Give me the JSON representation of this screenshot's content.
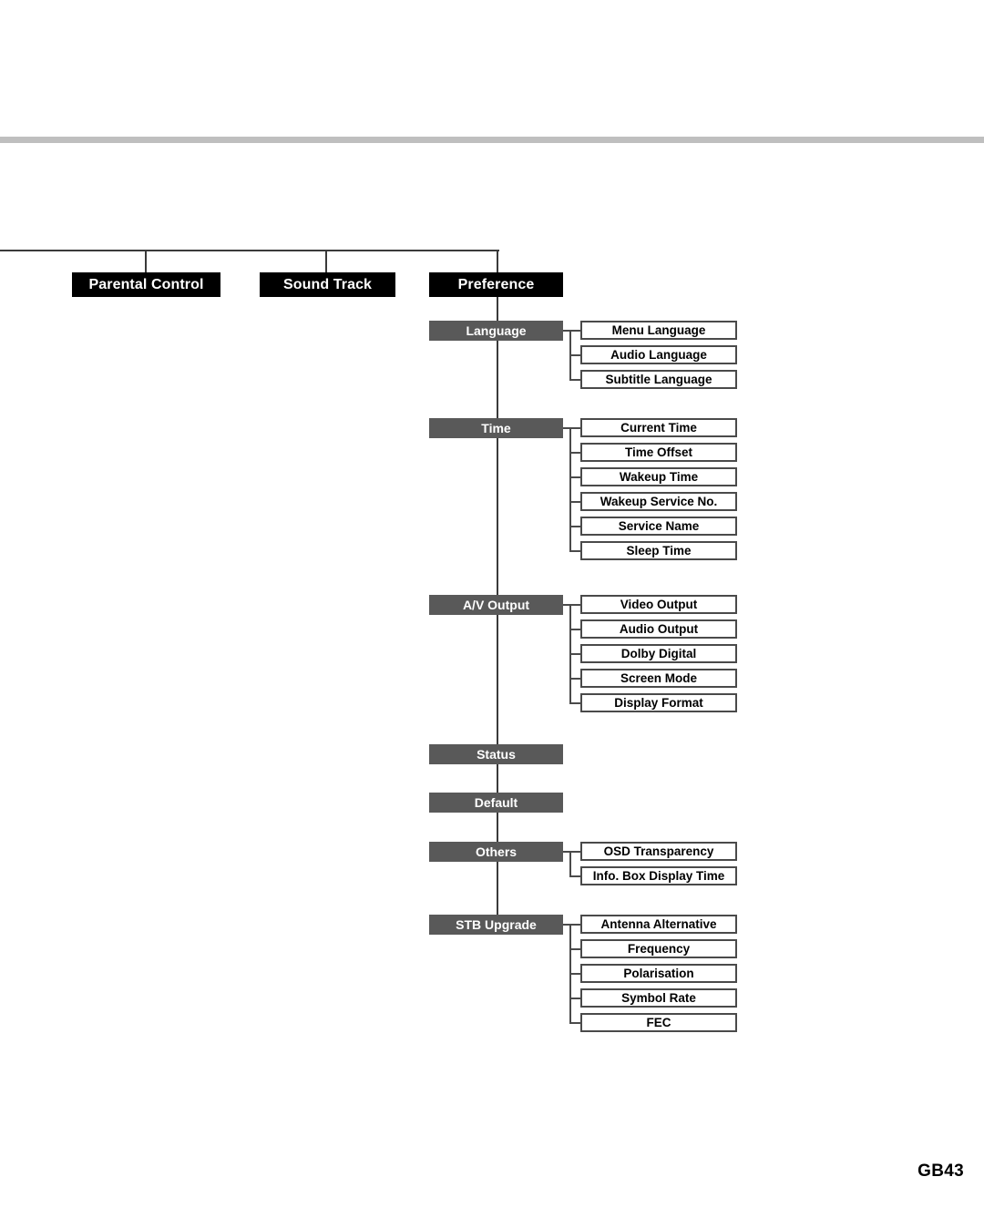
{
  "document": {
    "footer_page_label": "GB43",
    "colors": {
      "level1_box_bg": "#000000",
      "level2_box_bg": "#595959",
      "leaf_box_border": "#4a4a4a",
      "connector_line": "#3a3a3a",
      "header_rule": "#bfbfbf"
    }
  },
  "menu_tree": {
    "level1": [
      {
        "label": "Parental Control"
      },
      {
        "label": "Sound Track"
      },
      {
        "label": "Preference"
      }
    ],
    "preference_groups": [
      {
        "label": "Language",
        "items": [
          "Menu Language",
          "Audio Language",
          "Subtitle Language"
        ]
      },
      {
        "label": "Time",
        "items": [
          "Current Time",
          "Time Offset",
          "Wakeup Time",
          "Wakeup Service No.",
          "Service Name",
          "Sleep Time"
        ]
      },
      {
        "label": "A/V Output",
        "items": [
          "Video Output",
          "Audio Output",
          "Dolby Digital",
          "Screen Mode",
          "Display Format"
        ]
      },
      {
        "label": "Status",
        "items": []
      },
      {
        "label": "Default",
        "items": []
      },
      {
        "label": "Others",
        "items": [
          "OSD Transparency",
          "Info. Box Display Time"
        ]
      },
      {
        "label": "STB Upgrade",
        "items": [
          "Antenna Alternative",
          "Frequency",
          "Polarisation",
          "Symbol Rate",
          "FEC"
        ]
      }
    ]
  }
}
